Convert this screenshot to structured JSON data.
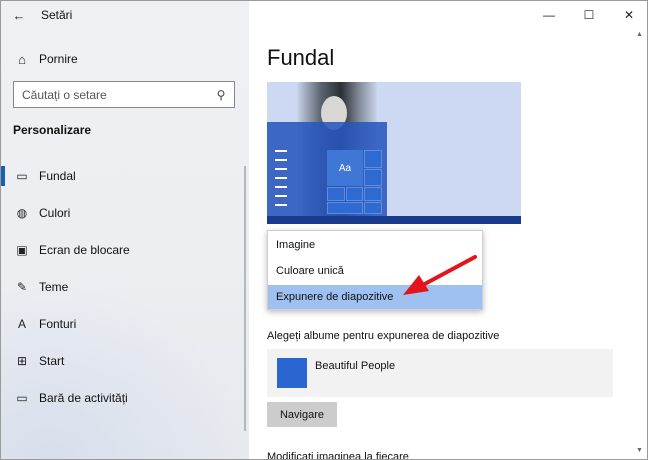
{
  "window": {
    "title": "Setări",
    "back_icon": "←",
    "controls": {
      "minimize": "—",
      "maximize": "☐",
      "close": "✕"
    }
  },
  "sidebar": {
    "home": {
      "icon": "⌂",
      "label": "Pornire"
    },
    "search": {
      "placeholder": "Căutați o setare",
      "icon": "⚲"
    },
    "section_title": "Personalizare",
    "items": [
      {
        "icon": "▭",
        "label": "Fundal",
        "active": true
      },
      {
        "icon": "◍",
        "label": "Culori",
        "active": false
      },
      {
        "icon": "▣",
        "label": "Ecran de blocare",
        "active": false
      },
      {
        "icon": "✎",
        "label": "Teme",
        "active": false
      },
      {
        "icon": "A",
        "label": "Fonturi",
        "active": false
      },
      {
        "icon": "⊞",
        "label": "Start",
        "active": false
      },
      {
        "icon": "▭",
        "label": "Bară de activități",
        "active": false
      }
    ]
  },
  "main": {
    "page_title": "Fundal",
    "preview": {
      "tile_label": "Aa"
    },
    "background_dropdown": {
      "options": [
        "Imagine",
        "Culoare unică",
        "Expunere de diapozitive"
      ],
      "selected": "Expunere de diapozitive"
    },
    "albums_label": "Alegeți albume pentru expunerea de diapozitive",
    "album": {
      "name": "Beautiful People",
      "color": "#2a65d0"
    },
    "browse_button": "Navigare",
    "change_label": "Modificați imaginea la fiecare"
  },
  "colors": {
    "accent": "#1a5fb4",
    "annotation_arrow": "#e3141b",
    "dropdown_highlight": "#9ec1f2"
  }
}
